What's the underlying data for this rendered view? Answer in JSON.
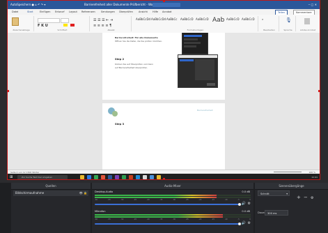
{
  "word": {
    "title": "Barrierefreiheit aller Dokumente Prüfbericht - Word",
    "tabs": [
      "Datei",
      "Start",
      "Einfügen",
      "Entwurf",
      "Layout",
      "Referenzen",
      "Sendungen",
      "Überprüfen",
      "Ansicht",
      "Hilfe",
      "Acrobat"
    ],
    "style_preview": "Aab",
    "groups": [
      "Zwischenablage",
      "Schriftart",
      "Absatz",
      "Formatvorlagen",
      "Bearbeiten",
      "Sprache",
      "Adobe Acrobat"
    ],
    "share_button": "Teilen",
    "comments_button": "Kommentare",
    "page1": {
      "line1": "Barrierefreiheit: Für alle Dokumente",
      "line2": "Öffnen Sie die Datei, die Sie prüfen möchten.",
      "step": "Step 2",
      "body1": "Klicken Sie auf Überprüfen und dann",
      "body2": "auf Barrierefreiheit überprüfen."
    },
    "page2": {
      "step": "Step 3",
      "logo_text": "Barrierefreiheit"
    },
    "status_left": "Seite 4 von 12   1500 Wörter",
    "status_right": "100 %"
  },
  "taskbar": {
    "search_placeholder": "Zur Suche Text hier eingeben",
    "time": "11:41",
    "icon_colors": [
      "#e8b92e",
      "#2c7be5",
      "#34a853",
      "#e0563b",
      "#2b579a",
      "#7b3fb4",
      "#2d9c4f",
      "#c43e1c",
      "#1f8ad6",
      "#d9d9d9",
      "#4a90d9"
    ]
  },
  "obs": {
    "sources": {
      "title": "Quellen",
      "items": [
        {
          "name": "Bildschirmaufnahme",
          "visible_icon": "eye-icon",
          "lock_icon": "lock-icon"
        }
      ]
    },
    "mixer": {
      "title": "Audio-Mixer",
      "channels": [
        {
          "name": "Desktop-Audio",
          "db": "0.0 dB",
          "level": 0.78,
          "volume": 1.0
        },
        {
          "name": "Mikrofon",
          "db": "0.0 dB",
          "level": 0.82,
          "volume": 1.0
        }
      ],
      "ticks": [
        "-60",
        "-55",
        "-50",
        "-45",
        "-40",
        "-35",
        "-30",
        "-25",
        "-20",
        "-15",
        "-10",
        "-5",
        "0"
      ]
    },
    "transitions": {
      "title": "Szenenübergänge",
      "selected": "Schnitt",
      "duration_label": "Dauer",
      "duration_value": "300 ms"
    },
    "colors": {
      "accent": "#3b6fd6",
      "meter_green": "#3bb64a",
      "selection_red": "#d01c1c"
    }
  }
}
